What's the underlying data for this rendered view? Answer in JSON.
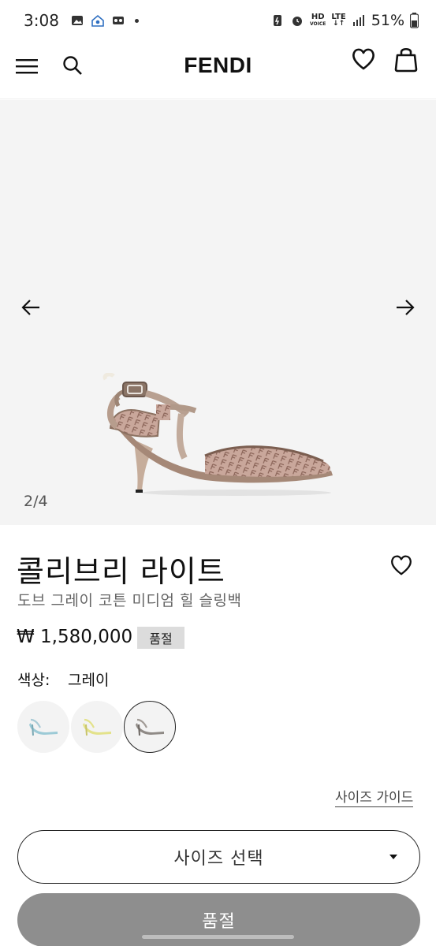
{
  "status_bar": {
    "time": "3:08",
    "network": "LTE",
    "hd_label": "HD",
    "hd_sub": "VOICE",
    "battery": "51%"
  },
  "header": {
    "logo": "FENDI",
    "icons": [
      "menu-icon",
      "search-icon",
      "heart-icon",
      "shopping-bag-icon"
    ]
  },
  "gallery": {
    "counter": "2/4",
    "icons": [
      "arrow-left-icon",
      "arrow-right-icon"
    ]
  },
  "product": {
    "title": "콜리브리 라이트",
    "subtitle": "도브 그레이 코튼 미디엄 힐 슬링백",
    "price": "₩ 1,580,000",
    "badge": "품절",
    "color_label": "색상:",
    "color_value": "그레이",
    "swatches": [
      {
        "name": "light-blue",
        "strap_color": "#a9cbd6"
      },
      {
        "name": "yellow",
        "strap_color": "#e3e28a"
      },
      {
        "name": "gray",
        "strap_color": "#8f8a86",
        "selected": true
      }
    ]
  },
  "actions": {
    "size_guide": "사이즈 가이드",
    "size_select": "사이즈 선택",
    "sold_out": "품절"
  },
  "colors": {
    "gallery_bg": "#f4f4f4",
    "soldout_button": "#8e8e8e",
    "badge_bg": "#dcdcdc"
  }
}
